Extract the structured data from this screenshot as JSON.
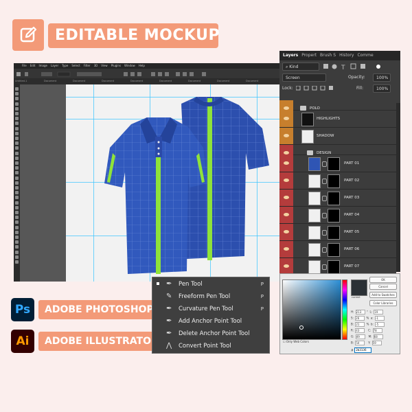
{
  "banner": {
    "title": "EDITABLE MOCKUP",
    "icon": "edit-icon"
  },
  "photoshop": {
    "menu": [
      "File",
      "Edit",
      "Image",
      "Layer",
      "Type",
      "Select",
      "Filter",
      "3D",
      "View",
      "Plugins",
      "Window",
      "Help"
    ],
    "tabs": [
      "Untitled-1",
      "Document",
      "Document",
      "Document",
      "Document",
      "Document",
      "Document",
      "Document",
      "Document"
    ]
  },
  "layers_panel": {
    "tabs": [
      "Layers",
      "Propert",
      "Brush S",
      "History",
      "Comme"
    ],
    "kind_label": "Kind",
    "blend_mode": "Screen",
    "opacity_label": "Opacity:",
    "opacity_value": "100%",
    "lock_label": "Lock:",
    "fill_label": "Fill:",
    "fill_value": "100%",
    "layers": [
      {
        "name": "POLO",
        "type": "group"
      },
      {
        "name": "HIGHLIGHTS",
        "type": "layer"
      },
      {
        "name": "SHADOW",
        "type": "layer"
      },
      {
        "name": "DESIGN",
        "type": "group"
      },
      {
        "name": "PART 01",
        "type": "smart"
      },
      {
        "name": "PART 02",
        "type": "smart"
      },
      {
        "name": "PART 03",
        "type": "smart"
      },
      {
        "name": "PART 04",
        "type": "smart"
      },
      {
        "name": "PART 05",
        "type": "smart"
      },
      {
        "name": "PART 06",
        "type": "smart"
      },
      {
        "name": "PART 07",
        "type": "smart"
      }
    ]
  },
  "color_picker": {
    "buttons": [
      "OK",
      "Cancel",
      "Add to Swatches",
      "Color Libraries"
    ],
    "only_web_colors": "Only Web Colors",
    "current_label": "current",
    "hex_label": "#",
    "hex_value": "2b3136",
    "values": [
      {
        "l": "H:",
        "v": "213",
        "u": "°",
        "l2": "L:",
        "v2": "19"
      },
      {
        "l": "S:",
        "v": "26",
        "u": "%",
        "l2": "a:",
        "v2": "-1"
      },
      {
        "l": "B:",
        "v": "21",
        "u": "%",
        "l2": "b:",
        "v2": "-5"
      },
      {
        "l": "R:",
        "v": "43",
        "u": "",
        "l2": "C:",
        "v2": "78"
      },
      {
        "l": "G:",
        "v": "49",
        "u": "",
        "l2": "M:",
        "v2": "68"
      },
      {
        "l": "B:",
        "v": "54",
        "u": "",
        "l2": "Y:",
        "v2": "59"
      }
    ]
  },
  "apps": [
    {
      "icon": "Ps",
      "label": "ADOBE PHOTOSHOP"
    },
    {
      "icon": "Ai",
      "label": "ADOBE ILLUSTRATOR"
    }
  ],
  "pen_menu": {
    "items": [
      {
        "label": "Pen Tool",
        "key": "P",
        "icon": "pen-icon"
      },
      {
        "label": "Freeform Pen Tool",
        "key": "P",
        "icon": "freeform-pen-icon"
      },
      {
        "label": "Curvature Pen Tool",
        "key": "P",
        "icon": "curvature-pen-icon"
      },
      {
        "label": "Add Anchor Point Tool",
        "key": "",
        "icon": "add-anchor-icon"
      },
      {
        "label": "Delete Anchor Point Tool",
        "key": "",
        "icon": "delete-anchor-icon"
      },
      {
        "label": "Convert Point Tool",
        "key": "",
        "icon": "convert-point-icon"
      }
    ]
  },
  "colors": {
    "accent": "#f39a78",
    "shirt": "#2f55b4",
    "stripe": "#8fe33a",
    "layer_eye": "#b43c3c"
  }
}
